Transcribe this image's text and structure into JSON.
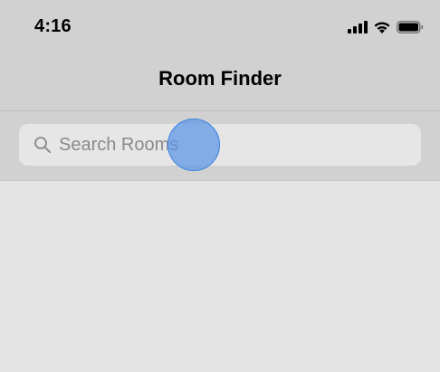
{
  "status_bar": {
    "time": "4:16",
    "icons": [
      "cellular-signal-icon",
      "wifi-icon",
      "battery-icon"
    ]
  },
  "nav": {
    "title": "Room Finder"
  },
  "search": {
    "placeholder": "Search Rooms",
    "value": "",
    "icon": "search-icon"
  },
  "colors": {
    "bar_background": "#d1d1d1",
    "content_background": "#e4e4e4",
    "search_field_background": "#e6e6e6",
    "placeholder_text": "#8a8a8e",
    "touch_indicator": "#5a96e6"
  }
}
